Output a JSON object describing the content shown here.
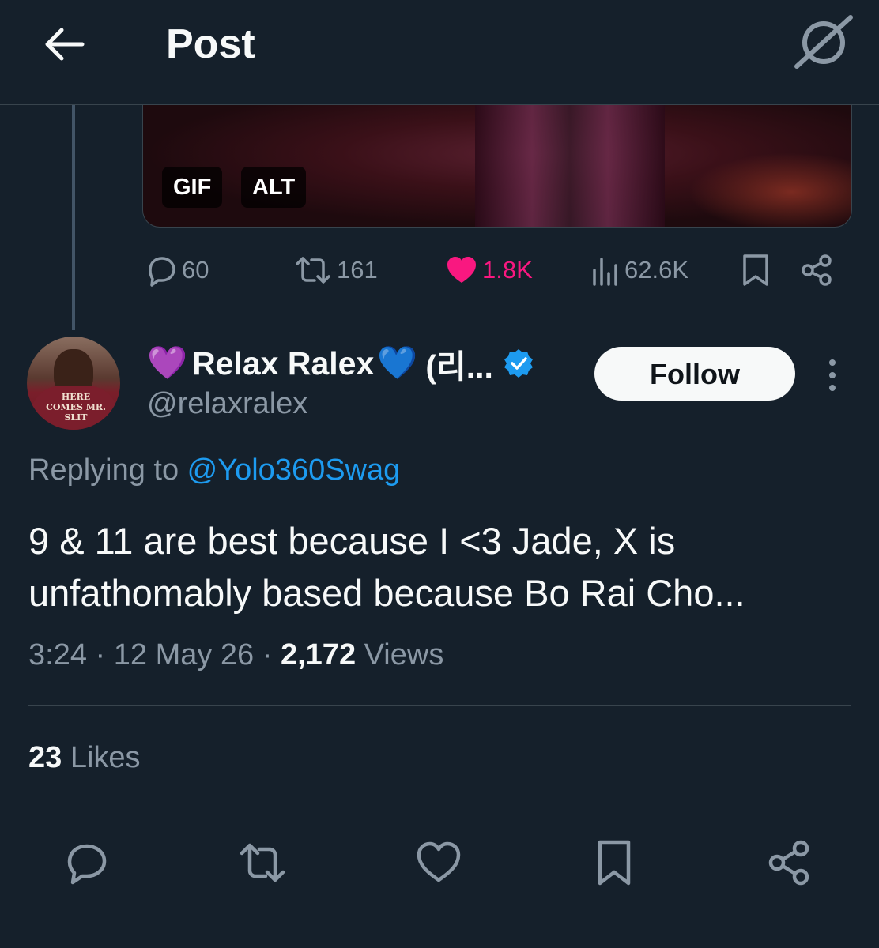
{
  "header": {
    "title": "Post",
    "back_icon": "arrow-left-icon",
    "grok_icon": "grok-icon"
  },
  "media": {
    "gif_badge": "GIF",
    "alt_badge": "ALT"
  },
  "parent_actions": {
    "replies": "60",
    "reposts": "161",
    "likes": "1.8K",
    "views": "62.6K"
  },
  "author": {
    "emoji_left": "💜",
    "name": "Relax Ralex",
    "emoji_right": "💙",
    "name_suffix": "(리...",
    "handle": "@relaxralex",
    "verified": true,
    "follow_label": "Follow",
    "avatar_shirt_text": "HERE COMES MR. SLIT"
  },
  "reply": {
    "prefix": "Replying to ",
    "to": "@Yolo360Swag"
  },
  "tweet": {
    "text": "9 & 11 are best because I <3 Jade, X is unfathomably based because Bo Rai Cho..."
  },
  "meta": {
    "time": "3:24",
    "date": "12 May 26",
    "views_count": "2,172",
    "views_label": "Views"
  },
  "stats": {
    "likes_count": "23",
    "likes_label": "Likes"
  },
  "colors": {
    "background": "#15202b",
    "accent": "#1d9bf0",
    "like": "#f91880",
    "muted": "#8b98a5"
  }
}
